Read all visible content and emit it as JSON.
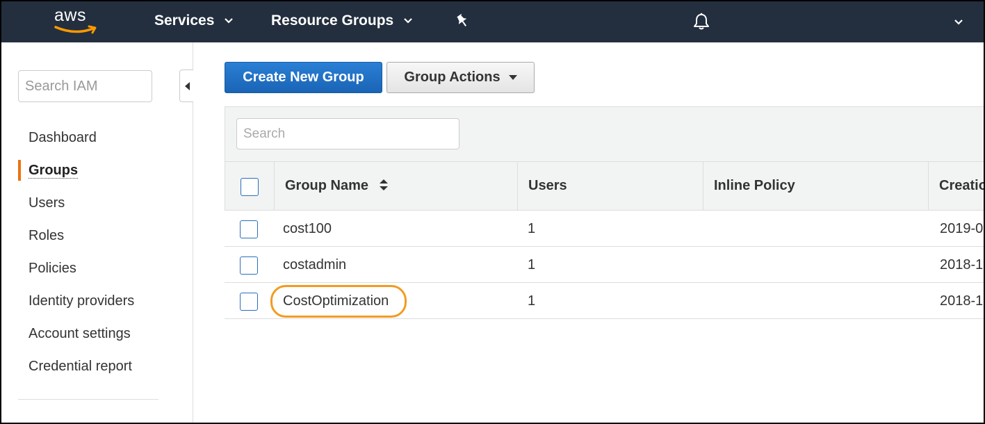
{
  "brand": {
    "logo_text": "aws",
    "accent": "#ff9900"
  },
  "topnav": {
    "services_label": "Services",
    "resource_groups_label": "Resource Groups",
    "pin_icon": "pin-icon",
    "bell_icon": "bell-icon"
  },
  "sidebar": {
    "search_placeholder": "Search IAM",
    "items": [
      {
        "label": "Dashboard"
      },
      {
        "label": "Groups",
        "active": true
      },
      {
        "label": "Users"
      },
      {
        "label": "Roles"
      },
      {
        "label": "Policies"
      },
      {
        "label": "Identity providers"
      },
      {
        "label": "Account settings"
      },
      {
        "label": "Credential report"
      }
    ]
  },
  "main": {
    "create_button_label": "Create New Group",
    "actions_button_label": "Group Actions",
    "search_placeholder": "Search",
    "table": {
      "columns": [
        "Group Name",
        "Users",
        "Inline Policy",
        "Creatio"
      ],
      "rows": [
        {
          "name": "cost100",
          "users": "1",
          "inline_policy": "",
          "created": "2019-0"
        },
        {
          "name": "costadmin",
          "users": "1",
          "inline_policy": "",
          "created": "2018-1"
        },
        {
          "name": "CostOptimization",
          "users": "1",
          "inline_policy": "",
          "created": "2018-1",
          "highlighted": true
        }
      ]
    }
  },
  "colors": {
    "nav_bg": "#232f3e",
    "primary_button": "#1a64b6",
    "active_indicator": "#ec7211",
    "highlight_outline": "#f29b21"
  }
}
